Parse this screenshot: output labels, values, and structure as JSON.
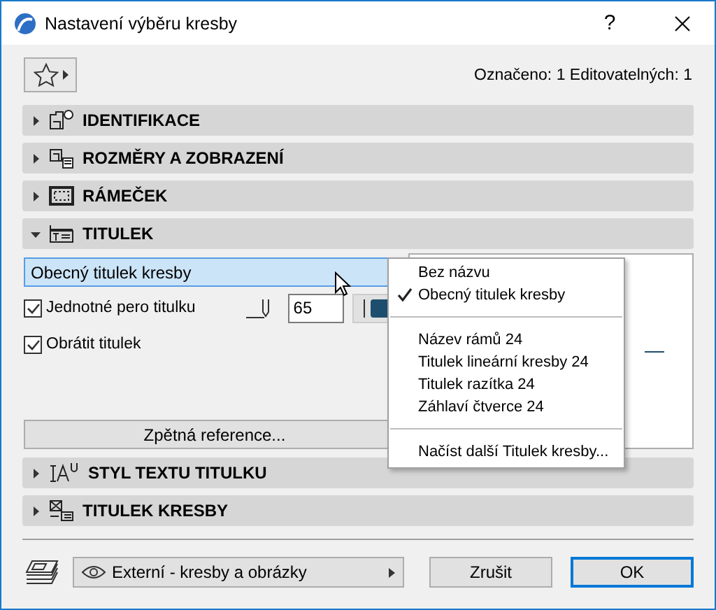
{
  "window": {
    "title": "Nastavení výběru kresby",
    "help": "?"
  },
  "selection_info": "Označeno: 1 Editovatelných: 1",
  "panels": [
    {
      "label": "IDENTIFIKACE",
      "expanded": false
    },
    {
      "label": "ROZMĚRY A ZOBRAZENÍ",
      "expanded": false
    },
    {
      "label": "RÁMEČEK",
      "expanded": false
    },
    {
      "label": "TITULEK",
      "expanded": true
    },
    {
      "label": "STYL TEXTU TITULKU",
      "expanded": false
    },
    {
      "label": "TITULEK KRESBY",
      "expanded": false
    }
  ],
  "title_settings": {
    "title_type": "Obecný titulek kresby",
    "checkboxes": [
      {
        "label": "Jednotné pero titulku",
        "checked": true
      },
      {
        "label": "Obrátit titulek",
        "checked": true
      }
    ],
    "pen": "65",
    "reference_button": "Zpětná reference..."
  },
  "menu": [
    {
      "kind": "item",
      "label": "Bez názvu",
      "checked": false
    },
    {
      "kind": "item",
      "label": "Obecný titulek kresby",
      "checked": true
    },
    {
      "kind": "separator"
    },
    {
      "kind": "item",
      "label": "Název rámů 24",
      "checked": false
    },
    {
      "kind": "item",
      "label": "Titulek lineární kresby 24",
      "checked": false
    },
    {
      "kind": "item",
      "label": "Titulek razítka 24",
      "checked": false
    },
    {
      "kind": "item",
      "label": "Záhlaví čtverce 24",
      "checked": false
    },
    {
      "kind": "separator"
    },
    {
      "kind": "item",
      "label": "Načíst další Titulek kresby...",
      "checked": false
    }
  ],
  "footer": {
    "layer": "Externí - kresby a obrázky",
    "buttons": [
      {
        "label": "Zrušit",
        "default": false
      },
      {
        "label": "OK",
        "default": true
      }
    ]
  }
}
